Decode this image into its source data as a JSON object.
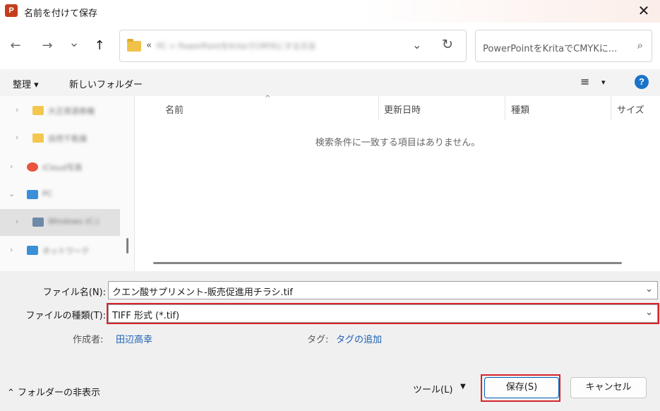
{
  "window": {
    "app_icon": "P",
    "title": "名前を付けて保存",
    "close": "✕"
  },
  "nav": {
    "back": "←",
    "forward": "→",
    "recent": "⌄",
    "up": "↑",
    "path_prefix": "«",
    "path": "PC > PowerPointをKritaでCMYKにする方法",
    "search_placeholder": "PowerPointをKritaでCMYKに...",
    "search_icon": "⌕"
  },
  "commands": {
    "organize": "整理 ▾",
    "new_folder": "新しいフォルダー",
    "view_icon": "≡",
    "view_caret": "▾",
    "help": "?"
  },
  "sidebar": {
    "items": [
      {
        "label": "大正資源券機",
        "icon_color": "#f3c74f"
      },
      {
        "label": "自然千乾燥",
        "icon_color": "#f3c74f"
      },
      {
        "label": "iCloud写真",
        "icon_color": "#e9553f"
      },
      {
        "label": "PC",
        "icon_color": "#3a8fd9"
      },
      {
        "label": "Windows (C:)",
        "icon_color": "#6e8aa8"
      },
      {
        "label": "ネットワーク",
        "icon_color": "#3a8fd9"
      }
    ]
  },
  "columns": {
    "name": "名前",
    "date": "更新日時",
    "type": "種類",
    "size": "サイズ"
  },
  "empty_message": "検索条件に一致する項目はありません。",
  "form": {
    "filename_label": "ファイル名(N):",
    "filename_value": "クエン酸サプリメント-販売促進用チラシ.tif",
    "filetype_label": "ファイルの種類(T):",
    "filetype_value": "TIFF 形式 (*.tif)",
    "author_label": "作成者:",
    "author_value": "田辺高幸",
    "tags_label": "タグ:",
    "tags_value": "タグの追加"
  },
  "footer": {
    "hide_folders": "⌃ フォルダーの非表示",
    "tools": "ツール(L)",
    "tools_caret": "▼",
    "save": "保存(S)",
    "cancel": "キャンセル"
  },
  "colors": {
    "highlight": "#d6242a",
    "accent": "#005fb8",
    "link": "#1a5fb4"
  }
}
